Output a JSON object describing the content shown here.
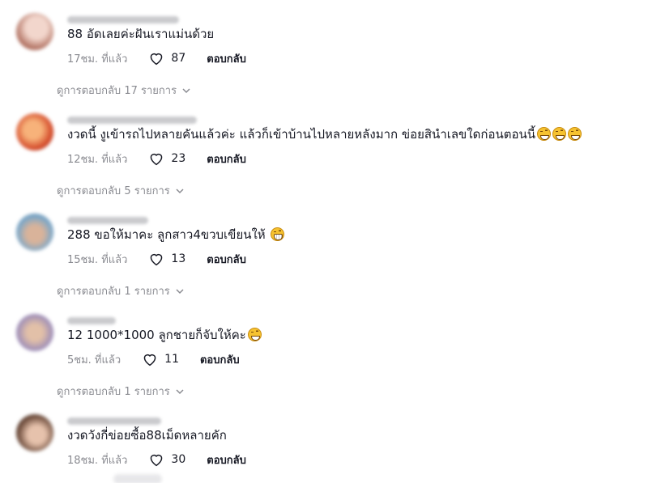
{
  "comments": [
    {
      "text": "88 อัดเลยค่ะฝันเราแม่นด้วย",
      "emojis": [],
      "time": "17ชม. ที่แล้ว",
      "likes": "87",
      "reply_label": "ตอบกลับ",
      "view_replies": "ดูการตอบกลับ 17 รายการ",
      "avatar_colors": [
        "#e9c2b8",
        "#b07060"
      ]
    },
    {
      "text": "งวดนี้ งูเข้ารถไปหลายคันแล้วค่ะ แล้วก็เข้าบ้านไปหลายหลังมาก ข่อยสินำเลขใดก่อนตอนนี้",
      "emojis": [
        "joy-emoji",
        "joy-emoji",
        "joy-emoji"
      ],
      "time": "12ชม. ที่แล้ว",
      "likes": "23",
      "reply_label": "ตอบกลับ",
      "view_replies": "ดูการตอบกลับ 5 รายการ",
      "avatar_colors": [
        "#d44a2a",
        "#f3a06a"
      ]
    },
    {
      "text": "288 ขอให้มาคะ ลูกสาว4ขวบเขียนให้",
      "emojis": [
        "grimacing-emoji"
      ],
      "time": "15ชม. ที่แล้ว",
      "likes": "13",
      "reply_label": "ตอบกลับ",
      "view_replies": "ดูการตอบกลับ 1 รายการ",
      "avatar_colors": [
        "#7aa7c9",
        "#c9a48a"
      ]
    },
    {
      "text": "12 1000*1000 ลูกชายก็จับให้คะ",
      "emojis": [
        "joy-emoji"
      ],
      "time": "5ชม. ที่แล้ว",
      "likes": "11",
      "reply_label": "ตอบกลับ",
      "view_replies": "ดูการตอบกลับ 1 รายการ",
      "avatar_colors": [
        "#9a8bb8",
        "#d9b39a"
      ]
    },
    {
      "text": "งวดวังกี่ข่อยซื้อ88เม็ดหลายคัก",
      "emojis": [],
      "time": "18ชม. ที่แล้ว",
      "likes": "30",
      "reply_label": "ตอบกลับ",
      "avatar_colors": [
        "#6b4a3a",
        "#d8b09a"
      ]
    }
  ]
}
